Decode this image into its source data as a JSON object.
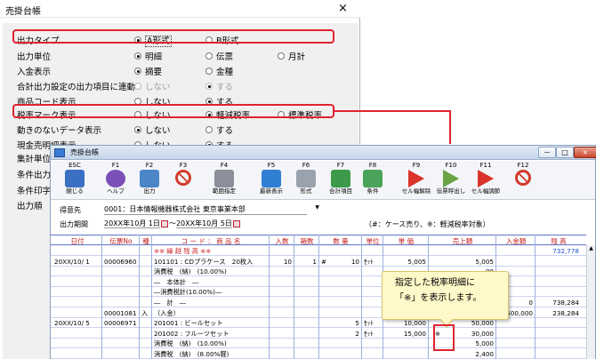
{
  "back_window": {
    "title": "売掛台帳",
    "close": "×",
    "rows": [
      {
        "label": "出力タイプ",
        "options": [
          {
            "text": "A形式",
            "selected": true,
            "focus": true
          },
          {
            "text": "B形式"
          }
        ]
      },
      {
        "label": "出力単位",
        "options": [
          {
            "text": "明細",
            "selected": true
          },
          {
            "text": "伝票"
          },
          {
            "text": "月計"
          }
        ]
      },
      {
        "label": "入金表示",
        "options": [
          {
            "text": "摘要",
            "selected": true
          },
          {
            "text": "金種"
          }
        ]
      },
      {
        "label": "合計出力設定の出力項目に連動",
        "options": [
          {
            "text": "しない",
            "disabled": true
          },
          {
            "text": "する",
            "selected": true,
            "disabled": true
          }
        ]
      },
      {
        "label": "商品コード表示",
        "options": [
          {
            "text": "しない"
          },
          {
            "text": "する",
            "selected": true
          }
        ]
      },
      {
        "label": "税率マーク表示",
        "options": [
          {
            "text": "しない"
          },
          {
            "text": "軽減税率",
            "selected": true
          },
          {
            "text": "標準税率"
          }
        ]
      },
      {
        "label": "動きのないデータ表示",
        "options": [
          {
            "text": "しない",
            "selected": true
          },
          {
            "text": "する"
          }
        ]
      },
      {
        "label": "現金売明細表示",
        "options": [
          {
            "text": "しない"
          },
          {
            "text": "する",
            "selected": true
          }
        ]
      },
      {
        "label": "集計単位",
        "options": []
      },
      {
        "label": "条件出力",
        "options": []
      },
      {
        "label": "条件印字",
        "options": []
      },
      {
        "label": "出力順",
        "options": []
      }
    ]
  },
  "front_window": {
    "title": "売掛台帳",
    "window_buttons": [
      "－",
      "□",
      "×"
    ],
    "toolbar": [
      {
        "fkey": "ESC",
        "label": "閉じる",
        "icon": "close-door-icon",
        "color": "#3a6fc4"
      },
      {
        "fkey": "F1",
        "label": "ヘルプ",
        "icon": "help-icon",
        "color": "#7b4fb8"
      },
      {
        "fkey": "F2",
        "label": "出力",
        "icon": "print-icon",
        "color": "#4a86c8"
      },
      {
        "fkey": "F3",
        "label": "",
        "icon": "prohibit-icon",
        "color": "#d23a2a"
      },
      {
        "fkey": "F4",
        "label": "範囲指定",
        "icon": "calendar-icon",
        "color": "#8a8f9a"
      },
      {
        "fkey": "F5",
        "label": "最新表示",
        "icon": "refresh-icon",
        "color": "#2f7fd3"
      },
      {
        "fkey": "F6",
        "label": "形式",
        "icon": "gear-icon",
        "color": "#9aa2ae"
      },
      {
        "fkey": "F7",
        "label": "合計項目",
        "icon": "table-icon",
        "color": "#3c9a4a"
      },
      {
        "fkey": "F8",
        "label": "条件",
        "icon": "filter-icon",
        "color": "#4aa35a"
      },
      {
        "fkey": "F9",
        "label": "セル幅解除",
        "icon": "play-icon",
        "color": "#d9332b"
      },
      {
        "fkey": "F10",
        "label": "伝票呼出し",
        "icon": "play-icon",
        "color": "#6aa343"
      },
      {
        "fkey": "F11",
        "label": "セル幅調節",
        "icon": "play-icon",
        "color": "#d9332b"
      },
      {
        "fkey": "F12",
        "label": "",
        "icon": "prohibit-icon",
        "color": "#d23a2a"
      }
    ],
    "info": {
      "customer_label": "得意先",
      "customer_value": "0001：日本情報機器株式会社 東京事業本部",
      "period_label": "出力期間",
      "period_from": "20XX年10月 1日",
      "period_sep": "～",
      "period_to": "20XX年10月 5日",
      "note": "（#：ケース売り、※：軽減税率対象）"
    },
    "columns": [
      "日付",
      "伝票No",
      "種",
      "コ ー ド ： 商 品 名",
      "入数",
      "箱数",
      "数 量",
      "単位",
      "単 価",
      "売上額",
      "入金額",
      "残 高"
    ],
    "rows": [
      {
        "date": "",
        "no": "",
        "kind": "",
        "name": "※※ 繰 越 残 高 ※※",
        "irisu": "",
        "hako": "",
        "qty": "",
        "unit": "",
        "price": "",
        "sales": "",
        "deposit": "",
        "balance": "732,778",
        "carry": true
      },
      {
        "date": "20XX/10/ 1",
        "no": "00006960",
        "kind": "",
        "name": "101101 : CDプラケース　20枚入",
        "irisu": "10",
        "hako": "1",
        "qty_mark": "#",
        "qty": "10",
        "unit": "ｾｯﾄ",
        "price": "5,005",
        "sales": "5,005",
        "deposit": "",
        "balance": ""
      },
      {
        "date": "",
        "no": "",
        "kind": "",
        "name": "消費税　(納)　(10.00%)",
        "irisu": "",
        "hako": "",
        "qty": "",
        "unit": "",
        "price": "",
        "sales": "00",
        "deposit": "",
        "balance": ""
      },
      {
        "date": "",
        "no": "",
        "kind": "",
        "name": "―　本体計　―",
        "irisu": "",
        "hako": "",
        "qty": "",
        "unit": "",
        "price": "",
        "sales": "05",
        "deposit": "",
        "balance": ""
      },
      {
        "date": "",
        "no": "",
        "kind": "",
        "name": "―消費税計(10.00%)―",
        "irisu": "",
        "hako": "",
        "qty": "",
        "unit": "",
        "price": "",
        "sales": "00",
        "deposit": "",
        "balance": ""
      },
      {
        "date": "",
        "no": "",
        "kind": "",
        "name": "―　計　―",
        "irisu": "",
        "hako": "",
        "qty": "",
        "unit": "",
        "price": "",
        "sales": "05",
        "deposit": "0",
        "balance": "738,284"
      },
      {
        "date": "",
        "no": "00001081",
        "kind": "入",
        "name": "（入金）",
        "irisu": "",
        "hako": "",
        "qty": "",
        "unit": "",
        "price": "",
        "sales": "",
        "deposit": "500,000",
        "balance": "238,284"
      },
      {
        "date": "20XX/10/ 5",
        "no": "00006971",
        "kind": "",
        "name": "201001 : ビールセット",
        "irisu": "",
        "hako": "",
        "qty": "5",
        "unit": "ｾｯﾄ",
        "price": "10,000",
        "sales": "50,000",
        "deposit": "",
        "balance": ""
      },
      {
        "date": "",
        "no": "",
        "kind": "",
        "name": "201002 : フルーツセット",
        "irisu": "",
        "hako": "",
        "qty": "2",
        "unit": "ｾｯﾄ",
        "price": "15,000",
        "mark": "※",
        "sales": "30,000",
        "deposit": "",
        "balance": ""
      },
      {
        "date": "",
        "no": "",
        "kind": "",
        "name": "消費税　(納)　(10.00%)",
        "irisu": "",
        "hako": "",
        "qty": "",
        "unit": "",
        "price": "",
        "sales": "5,000",
        "deposit": "",
        "balance": ""
      },
      {
        "date": "",
        "no": "",
        "kind": "",
        "name": "消費税　(納)　(8.00%軽)",
        "irisu": "",
        "hako": "",
        "qty": "",
        "unit": "",
        "price": "",
        "sales": "2,400",
        "deposit": "",
        "balance": ""
      }
    ]
  },
  "callout": {
    "line1": "指定した税率明細に",
    "line2": "「※」を表示します。"
  },
  "colors": {
    "highlight": "#e0232e",
    "header_text": "#c21b1b",
    "carry_text": "#d0262a",
    "balance_blue": "#1f4fd0",
    "callout_bg": "#fff8c8"
  }
}
